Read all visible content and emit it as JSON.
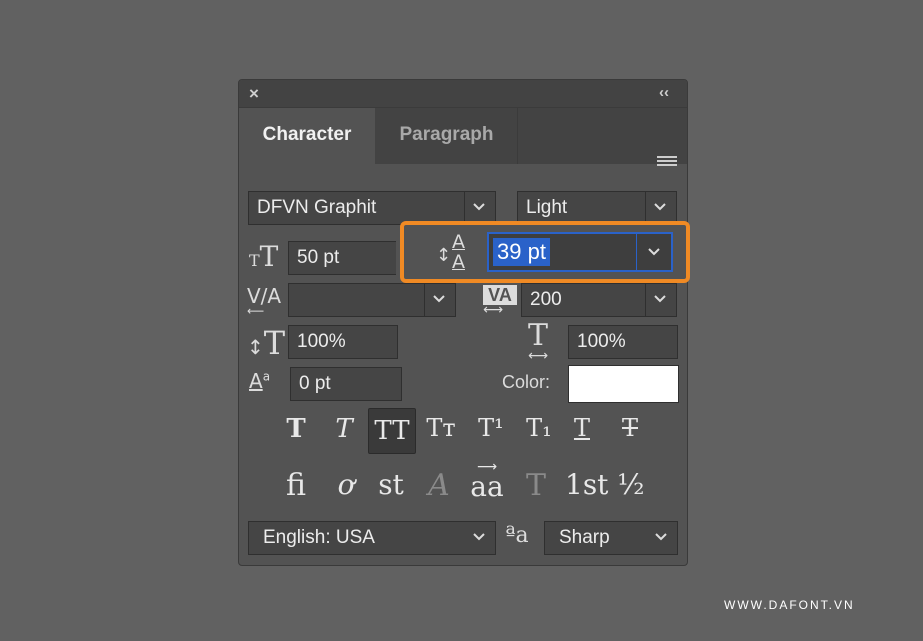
{
  "panel": {
    "close_icon": "×",
    "collapse_icon": "‹‹",
    "tabs": [
      "Character",
      "Paragraph"
    ],
    "menu_icon": "hamburger-menu-icon"
  },
  "font": {
    "family": "DFVN Graphit",
    "style": "Light"
  },
  "size": {
    "font_size": "50 pt",
    "leading": "39 pt"
  },
  "kerning": {
    "value": "",
    "tracking": "200"
  },
  "scale": {
    "vertical": "100%",
    "horizontal": "100%"
  },
  "baseline": {
    "shift": "0 pt"
  },
  "color": {
    "label": "Color:",
    "swatch": "#ffffff"
  },
  "style_buttons": [
    "T",
    "T",
    "TT",
    "Tт",
    "T¹",
    "T₁",
    "T",
    "T"
  ],
  "opentype_buttons": [
    "ﬁ",
    "ơ",
    "st",
    "A",
    "aa",
    "T",
    "1st",
    "½"
  ],
  "language": {
    "value": "English: USA",
    "aa_icon": "ªa",
    "antialias": "Sharp"
  },
  "watermark": "WWW.DAFONT.VN",
  "colors": {
    "highlight": "#f08a24",
    "selection": "#2a62c9"
  }
}
